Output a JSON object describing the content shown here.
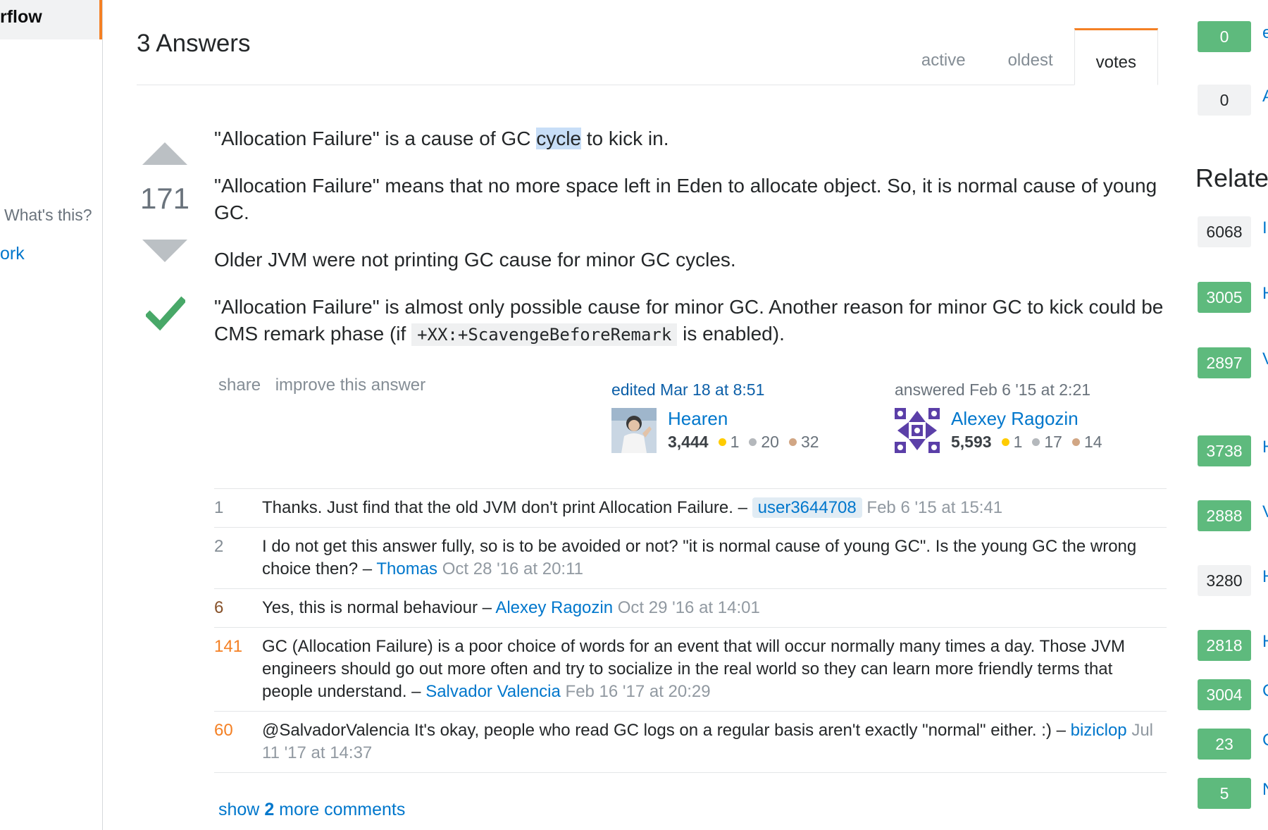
{
  "left_sidebar": {
    "active_item": "rflow",
    "whats_this": "What's this?",
    "link_fragment": "ork"
  },
  "answers": {
    "count_label": "3 Answers",
    "tabs": [
      {
        "label": "active",
        "active": false
      },
      {
        "label": "oldest",
        "active": false
      },
      {
        "label": "votes",
        "active": true
      }
    ]
  },
  "answer": {
    "votes": "171",
    "accepted": true,
    "paragraphs": {
      "p1_before": "\"Allocation Failure\" is a cause of GC ",
      "p1_highlight": "cycle",
      "p1_after": " to kick in.",
      "p2": "\"Allocation Failure\" means that no more space left in Eden to allocate object. So, it is normal cause of young GC.",
      "p3": "Older JVM were not printing GC cause for minor GC cycles.",
      "p4_before": "\"Allocation Failure\" is almost only possible cause for minor GC. Another reason for minor GC to kick could be CMS remark phase (if ",
      "p4_code": "+XX:+ScavengeBeforeRemark",
      "p4_after": " is enabled)."
    },
    "menu": {
      "share": "share",
      "improve": "improve this answer"
    },
    "edited": {
      "action": "edited Mar 18 at 8:51",
      "user": "Hearen",
      "rep": "3,444",
      "gold": "1",
      "silver": "20",
      "bronze": "32"
    },
    "answered": {
      "action": "answered Feb 6 '15 at 2:21",
      "user": "Alexey Ragozin",
      "rep": "5,593",
      "gold": "1",
      "silver": "17",
      "bronze": "14"
    }
  },
  "comments": [
    {
      "score": "1",
      "text": "Thanks. Just find that the old JVM don't print Allocation Failure. – ",
      "user": "user3644708",
      "date": "Feb 6 '15 at 15:41"
    },
    {
      "score": "2",
      "text": "I do not get this answer fully, so is to be avoided or not? \"it is normal cause of young GC\". Is the young GC the wrong choice then? – ",
      "user": "Thomas",
      "date": "Oct 28 '16 at 20:11"
    },
    {
      "score": "6",
      "text": "Yes, this is normal behaviour – ",
      "user": "Alexey Ragozin",
      "date": "Oct 29 '16 at 14:01"
    },
    {
      "score": "141",
      "text": "GC (Allocation Failure) is a poor choice of words for an event that will occur normally many times a day. Those JVM engineers should go out more often and try to socialize in the real world so they can learn more friendly terms that people understand. – ",
      "user": "Salvador Valencia",
      "date": "Feb 16 '17 at 20:29"
    },
    {
      "score": "60",
      "text": "@SalvadorValencia It's okay, people who read GC logs on a regular basis aren't exactly \"normal\" either. :) – ",
      "user": "biziclop",
      "date": "Jul 11 '17 at 14:37"
    }
  ],
  "show_more": {
    "prefix": "show ",
    "count": "2",
    "suffix": " more comments"
  },
  "right_sidebar": {
    "linked": [
      {
        "score": "0",
        "style": "green",
        "text": "e"
      },
      {
        "score": "0",
        "style": "gray",
        "text": "A"
      }
    ],
    "related_heading": "Relate",
    "related": [
      {
        "score": "6068",
        "style": "gray",
        "text": "I"
      },
      {
        "score": "3005",
        "style": "green",
        "text": "H"
      },
      {
        "score": "2897",
        "style": "green",
        "text": "V"
      },
      {
        "score": "3738",
        "style": "green",
        "text": "H"
      },
      {
        "score": "2888",
        "style": "green",
        "text": "V"
      },
      {
        "score": "3280",
        "style": "gray",
        "text": "H"
      },
      {
        "score": "2818",
        "style": "green",
        "text": "H"
      },
      {
        "score": "3004",
        "style": "green",
        "text": "C"
      },
      {
        "score": "23",
        "style": "green",
        "text": "C"
      },
      {
        "score": "5",
        "style": "green",
        "text": "N"
      }
    ]
  },
  "colors": {
    "accent_orange": "#f48024",
    "link_blue": "#0077cc",
    "accepted_green": "#48a868",
    "badge_green": "#5eba7d"
  }
}
